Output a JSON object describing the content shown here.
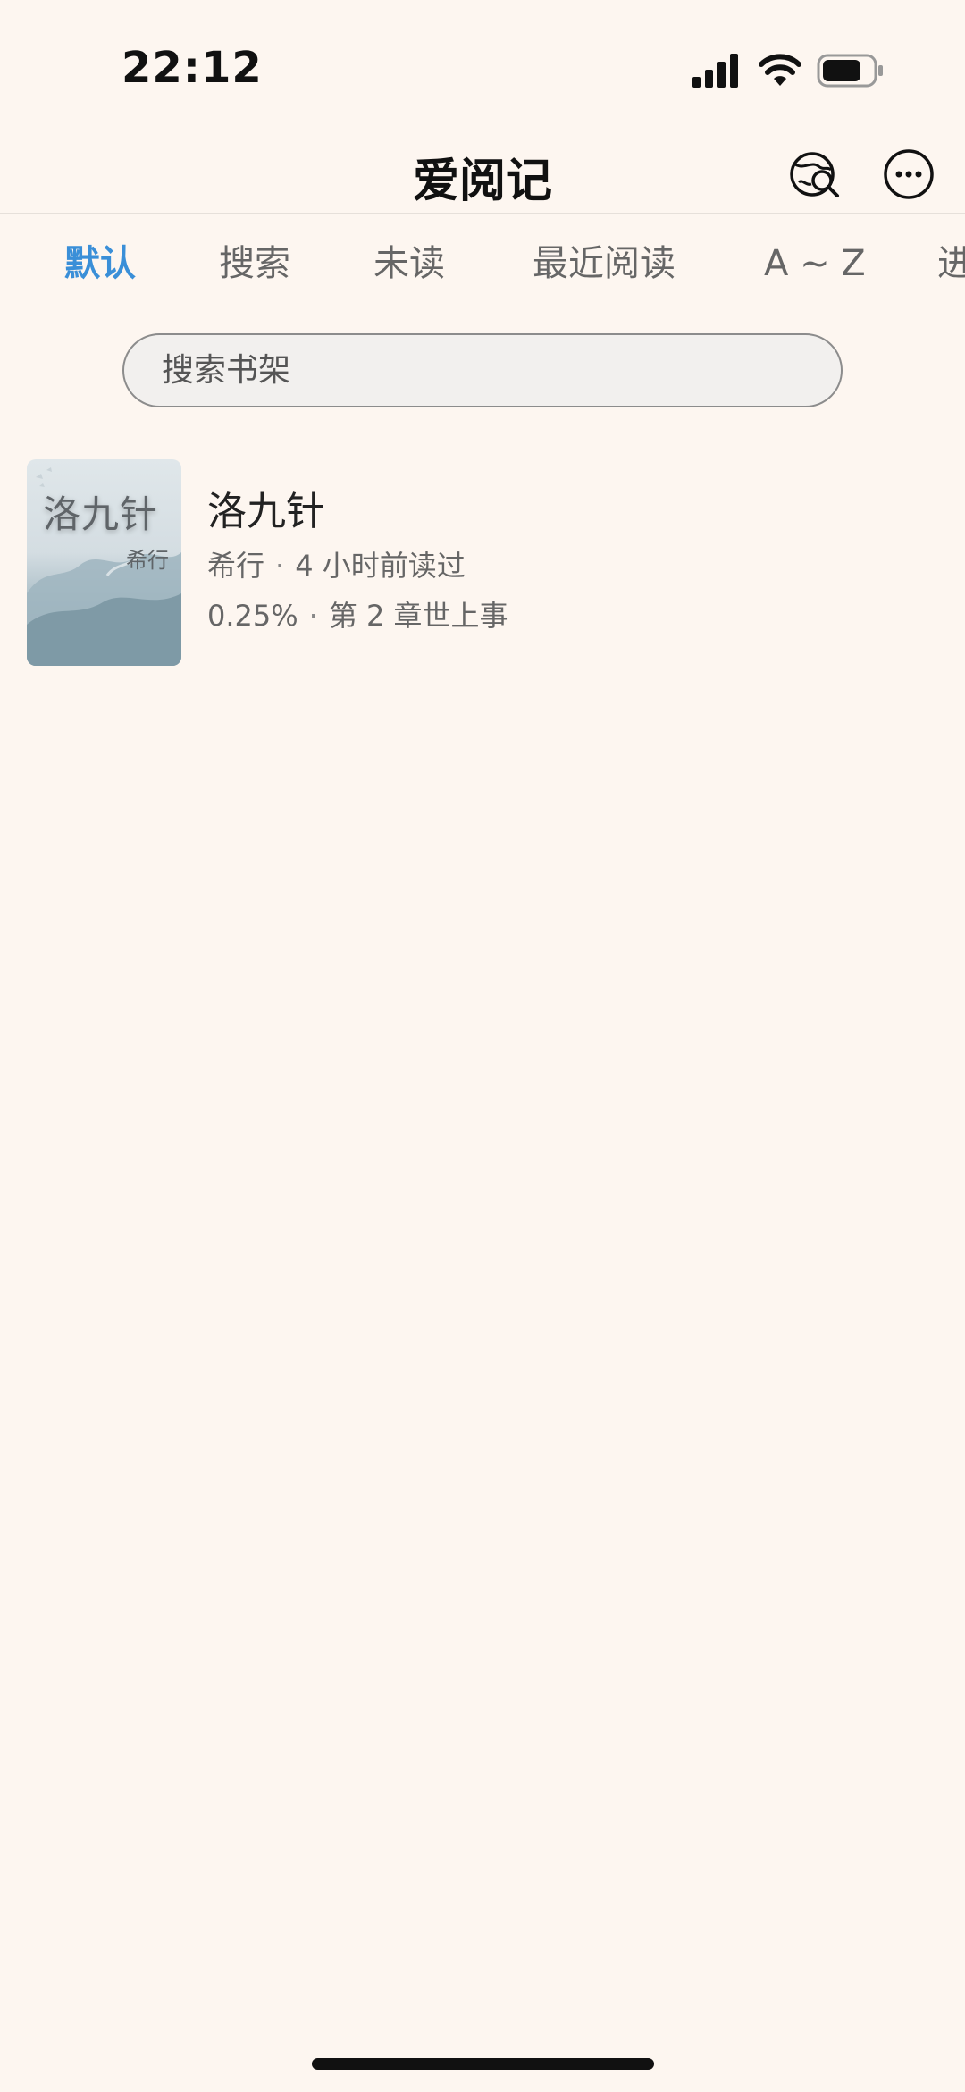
{
  "status_bar": {
    "time": "22:12"
  },
  "nav": {
    "title": "爱阅记"
  },
  "tabs": [
    {
      "label": "默认",
      "active": true
    },
    {
      "label": "搜索",
      "active": false
    },
    {
      "label": "未读",
      "active": false
    },
    {
      "label": "最近阅读",
      "active": false
    },
    {
      "label": "A ~ Z",
      "active": false
    },
    {
      "label": "进",
      "active": false
    }
  ],
  "search": {
    "placeholder": "搜索书架"
  },
  "books": [
    {
      "cover_title": "洛九针",
      "cover_author": "希行",
      "title": "洛九针",
      "author": "希行",
      "last_read": "4 小时前读过",
      "progress": "0.25%",
      "chapter": "第 2 章世上事"
    }
  ],
  "colors": {
    "background": "#fdf6f0",
    "accent": "#3a8fd8"
  }
}
